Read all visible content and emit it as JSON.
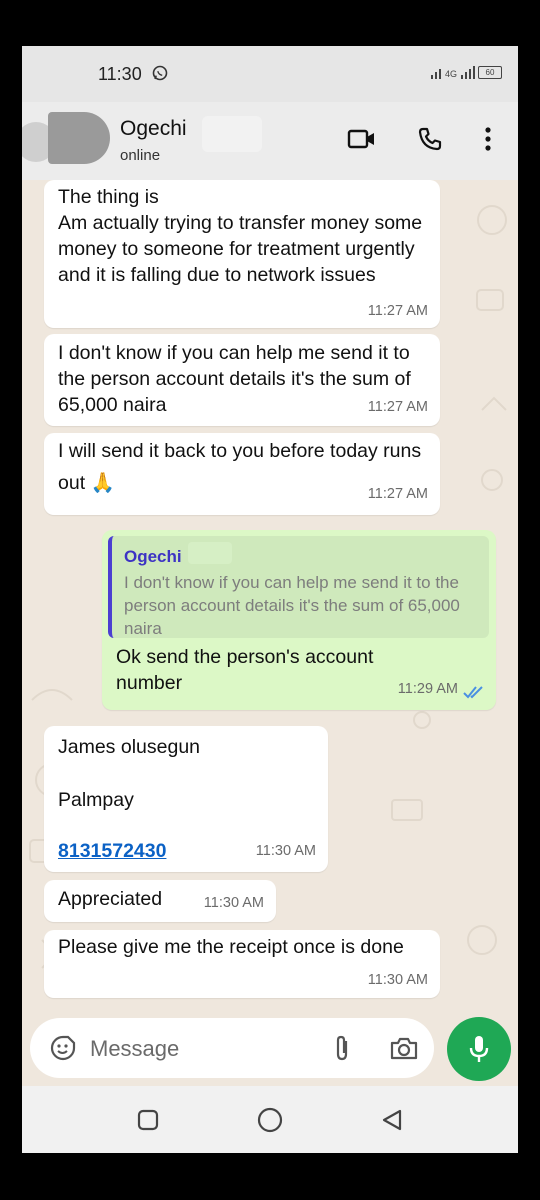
{
  "status_bar": {
    "time": "11:30",
    "network": "4G",
    "battery": "60"
  },
  "header": {
    "contact_name": "Ogechi",
    "contact_status": "online"
  },
  "messages": [
    {
      "direction": "in",
      "text": "The thing is\nAm actually trying to transfer money some money to someone for treatment urgently and it is falling due to network issues",
      "time": "11:27 AM"
    },
    {
      "direction": "in",
      "text": "I don't know if you can help me send it to the person account details it's the sum of 65,000 naira",
      "time": "11:27 AM"
    },
    {
      "direction": "in",
      "text": "I will send it back to you before today runs out 🙏",
      "time": "11:27 AM"
    },
    {
      "direction": "out",
      "quoted_name": "Ogechi",
      "quoted_text": "I don't know if you can help me send it to the person account details it's the sum of 65,000 naira",
      "text": "Ok send the person's account number",
      "time": "11:29 AM",
      "status": "read"
    },
    {
      "direction": "in",
      "line1": "James olusegun",
      "line2": "Palmpay",
      "link": "8131572430",
      "time": "11:30 AM"
    },
    {
      "direction": "in",
      "text": "Appreciated",
      "time": "11:30 AM"
    },
    {
      "direction": "in",
      "text": "Please give me the receipt once is done",
      "time": "11:30 AM"
    }
  ],
  "composer": {
    "placeholder": "Message"
  },
  "icons": {
    "header": [
      "video-call-icon",
      "phone-call-icon",
      "more-vert-icon"
    ],
    "composer": [
      "emoji-icon",
      "attach-icon",
      "camera-icon",
      "mic-icon"
    ],
    "navbar": [
      "recents-icon",
      "home-icon",
      "back-icon"
    ]
  },
  "colors": {
    "incoming": "#ffffff",
    "outgoing": "#dcf8c6",
    "accent": "#1fa855",
    "read_ticks": "#4a90e2",
    "link": "#0b61c5"
  }
}
